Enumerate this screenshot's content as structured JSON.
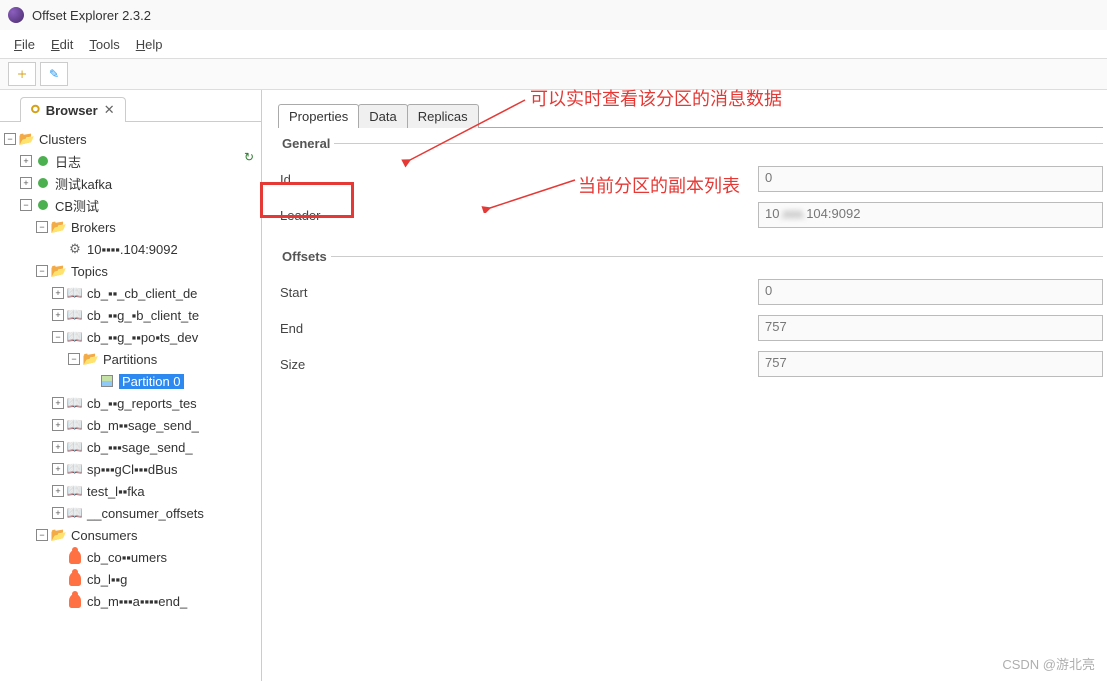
{
  "window": {
    "title": "Offset Explorer  2.3.2"
  },
  "menu": [
    "File",
    "Edit",
    "Tools",
    "Help"
  ],
  "sidebar_tab": {
    "label": "Browser"
  },
  "tree": {
    "root": "Clusters",
    "c1": "日志",
    "c2": "测试kafka",
    "c3": "CB测试",
    "brokers": "Brokers",
    "broker0": "10▪▪▪▪.104:9092",
    "topics": "Topics",
    "t0": "cb_▪▪_cb_client_de",
    "t1": "cb_▪▪g_▪b_client_te",
    "t2": "cb_▪▪g_▪▪po▪ts_dev",
    "partitions": "Partitions",
    "p0": "Partition 0",
    "t3": "cb_▪▪g_reports_tes",
    "t4": "cb_m▪▪sage_send_",
    "t5": "cb_▪▪▪sage_send_",
    "t6": "sp▪▪▪gCl▪▪▪dBus",
    "t7": "test_l▪▪fka",
    "t8": "__consumer_offsets",
    "consumers": "Consumers",
    "co0": "cb_co▪▪umers",
    "co1": "cb_l▪▪g",
    "co2": "cb_m▪▪▪a▪▪▪▪end_"
  },
  "content_tabs": {
    "t0": "Properties",
    "t1": "Data",
    "t2": "Replicas"
  },
  "general": {
    "legend": "General",
    "id_label": "Id",
    "id_val": "0",
    "leader_label": "Leader",
    "leader_val_a": "10",
    "leader_val_b": "104:9092"
  },
  "offsets": {
    "legend": "Offsets",
    "start_label": "Start",
    "start_val": "0",
    "end_label": "End",
    "end_val": "757",
    "size_label": "Size",
    "size_val": "757"
  },
  "annotations": {
    "a1": "可以实时查看该分区的消息数据",
    "a2": "当前分区的副本列表"
  },
  "watermark": "CSDN @游北亮"
}
